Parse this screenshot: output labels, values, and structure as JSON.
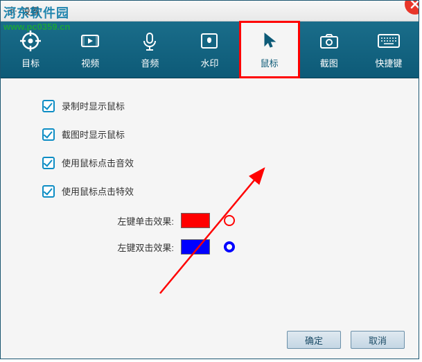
{
  "window": {
    "title": "设置"
  },
  "watermark": {
    "text": "河东软件园",
    "url": "www.pc0359.cn"
  },
  "tabs": [
    {
      "label": "目标",
      "icon": "target-icon"
    },
    {
      "label": "视频",
      "icon": "video-icon"
    },
    {
      "label": "音频",
      "icon": "audio-icon"
    },
    {
      "label": "水印",
      "icon": "watermark-icon"
    },
    {
      "label": "鼠标",
      "icon": "mouse-icon",
      "active": true,
      "highlighted": true
    },
    {
      "label": "截图",
      "icon": "screenshot-icon"
    },
    {
      "label": "快捷键",
      "icon": "keyboard-icon"
    }
  ],
  "options": {
    "show_cursor_record": {
      "label": "录制时显示鼠标",
      "checked": true
    },
    "show_cursor_shot": {
      "label": "截图时显示鼠标",
      "checked": true
    },
    "click_sound": {
      "label": "使用鼠标点击音效",
      "checked": true
    },
    "click_effect": {
      "label": "使用鼠标点击特效",
      "checked": true
    }
  },
  "click_effects": {
    "single": {
      "label": "左键单击效果:",
      "color": "#ff0000"
    },
    "double": {
      "label": "左键双击效果:",
      "color": "#0000ff"
    }
  },
  "buttons": {
    "ok": "确定",
    "cancel": "取消"
  }
}
